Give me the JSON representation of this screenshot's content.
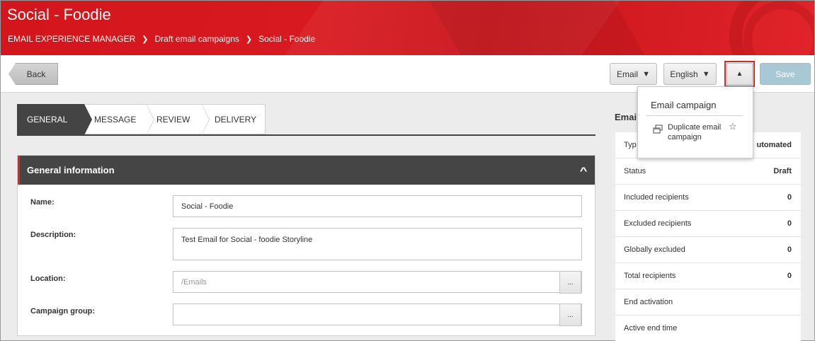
{
  "header": {
    "title": "Social - Foodie",
    "breadcrumb": [
      "EMAIL EXPERIENCE MANAGER",
      "Draft email campaigns",
      "Social - Foodie"
    ]
  },
  "toolbar": {
    "back_label": "Back",
    "email_label": "Email",
    "language_label": "English",
    "save_label": "Save"
  },
  "dropdown": {
    "title": "Email campaign",
    "item_label": "Duplicate email campaign"
  },
  "tabs": [
    {
      "label": "GENERAL",
      "active": true
    },
    {
      "label": "MESSAGE",
      "active": false
    },
    {
      "label": "REVIEW",
      "active": false
    },
    {
      "label": "DELIVERY",
      "active": false
    }
  ],
  "general": {
    "heading": "General information",
    "name_label": "Name:",
    "name_value": "Social - Foodie",
    "description_label": "Description:",
    "description_value": "Test Email for Social - foodie Storyline",
    "location_label": "Location:",
    "location_placeholder": "/Emails",
    "campaign_group_label": "Campaign group:",
    "campaign_group_value": "",
    "browse_label": "..."
  },
  "side": {
    "title": "Emai",
    "rows": [
      {
        "label": "Typ",
        "value": "utomated"
      },
      {
        "label": "Status",
        "value": "Draft"
      },
      {
        "label": "Included recipients",
        "value": "0"
      },
      {
        "label": "Excluded recipients",
        "value": "0"
      },
      {
        "label": "Globally excluded",
        "value": "0"
      },
      {
        "label": "Total recipients",
        "value": "0"
      },
      {
        "label": "End activation",
        "value": ""
      },
      {
        "label": "Active end time",
        "value": ""
      }
    ]
  },
  "colors": {
    "brand_red": "#d81a20",
    "dark_panel": "#454545",
    "save_disabled": "#a9c8d6",
    "highlight_border": "#e0231f"
  }
}
